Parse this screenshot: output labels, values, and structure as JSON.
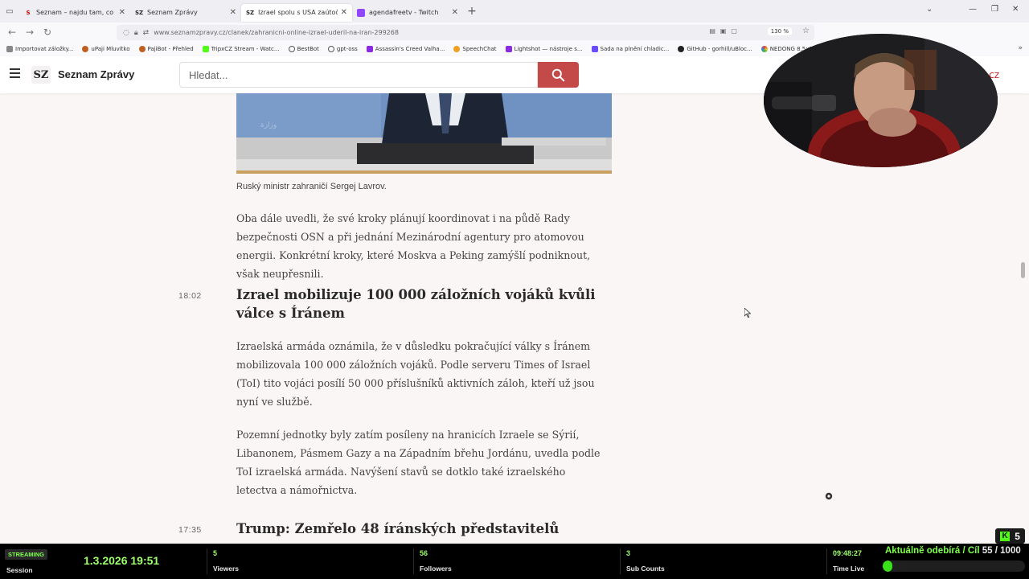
{
  "browser": {
    "tabs": [
      {
        "label": "Seznam – najdu tam, co neznám",
        "favicon": "S",
        "active": false
      },
      {
        "label": "Seznam Zprávy",
        "favicon": "SZ",
        "active": false
      },
      {
        "label": "Izrael spolu s USA zaútočili na Írán",
        "favicon": "SZ",
        "active": true
      },
      {
        "label": "agendafreetv - Twitch",
        "favicon": "twitch",
        "active": false
      }
    ],
    "url": "www.seznamzpravy.cz/clanek/zahranicni-online-izrael-uderil-na-iran-299268",
    "zoom": "130 %",
    "bookmarks": [
      {
        "label": "Importovat záložky...",
        "color": "#888888"
      },
      {
        "label": "uPaji Mluvítko",
        "color": "#c06020"
      },
      {
        "label": "PajiBot - Přehled",
        "color": "#c06020"
      },
      {
        "label": "TripxCZ Stream - Watc...",
        "color": "#53fc18"
      },
      {
        "label": "BestBot",
        "color": "#555555"
      },
      {
        "label": "gpt-oss",
        "color": "#555555"
      },
      {
        "label": "Assassin's Creed Valha...",
        "color": "#8a2be2"
      },
      {
        "label": "SpeechChat",
        "color": "#f0a020"
      },
      {
        "label": "Lightshot — nástroje s...",
        "color": "#8a2be2"
      },
      {
        "label": "Sada na plnění chladic...",
        "color": "#6a4cff"
      },
      {
        "label": "GitHub - gorhill/uBloc...",
        "color": "#222222"
      },
      {
        "label": "NEDONG 8,5x2 Bezdu...",
        "color": "#e04040"
      }
    ]
  },
  "site": {
    "logo_mark": "SZ",
    "logo_text": "Seznam Zprávy",
    "search_placeholder": "Hledat...",
    "header_right_fragment": "m.cz",
    "brand_color": "#c44a4a"
  },
  "article": {
    "caption": "Ruský ministr zahraničí Sergej Lavrov.",
    "para_intro": "Oba dále uvedli, že své kroky plánují koordinovat i na půdě Rady bezpečnosti OSN a při jednání Mezinárodní agentury pro atomovou energii. Konkrétní kroky, které Moskva a Peking zamýšlí podniknout, však neupřesnili.",
    "entries": [
      {
        "time": "18:02",
        "headline": "Izrael mobilizuje 100 000 záložních vojáků kvůli válce s Íránem",
        "paragraphs": [
          "Izraelská armáda oznámila, že v důsledku pokračující války s Íránem mobilizovala 100 000 záložních vojáků. Podle serveru Times of Israel (ToI) tito vojáci posílí 50 000 příslušníků aktivních záloh, kteří už jsou nyní ve službě.",
          "Pozemní jednotky byly zatím posíleny na hranicích Izraele se Sýrií, Libanonem, Pásmem Gazy a na Západním břehu Jordánu, uvedla podle ToI izraelská armáda. Navýšení stavů se dotklo také izraelského letectva a námořnictva."
        ]
      },
      {
        "time": "17:35",
        "headline": "Trump: Zemřelo 48 íránských představitelů",
        "paragraphs": []
      }
    ]
  },
  "stream": {
    "kick_count": "5",
    "streaming_label": "STREAMING",
    "session_label": "Session",
    "datetime": "1.3.2026 19:51",
    "viewers_value": "5",
    "viewers_label": "Viewers",
    "followers_value": "56",
    "followers_label": "Followers",
    "subs_value": "3",
    "subs_label": "Sub Counts",
    "time_live_value": "09:48:27",
    "time_live_label": "Time Live",
    "goal_label": "Aktuálně odebírá / Cíl",
    "goal_count": "55 / 1000",
    "goal_fraction": 0.055,
    "accent": "#53fc18"
  }
}
